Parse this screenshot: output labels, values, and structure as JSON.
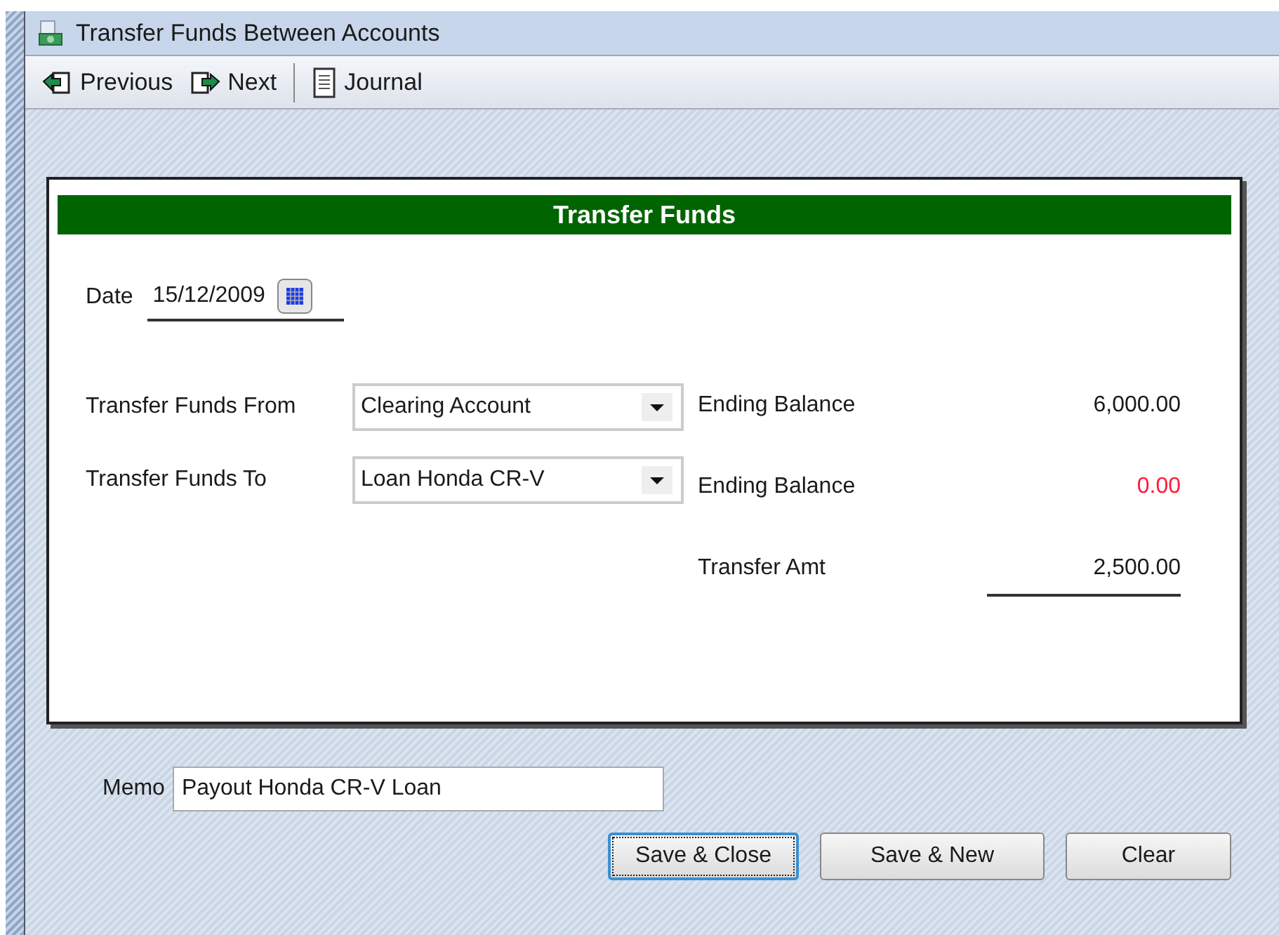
{
  "window": {
    "title": "Transfer Funds Between Accounts"
  },
  "toolbar": [
    {
      "kind": "previous",
      "label": "Previous"
    },
    {
      "kind": "next",
      "label": "Next"
    },
    {
      "kind": "journal",
      "label": "Journal"
    }
  ],
  "form": {
    "title": "Transfer Funds",
    "date": {
      "label": "Date",
      "value": "15/12/2009"
    },
    "accounts": [
      {
        "label": "Transfer Funds From",
        "value": "Clearing Account"
      },
      {
        "label": "Transfer Funds To",
        "value": "Loan Honda CR-V"
      }
    ],
    "amounts": [
      {
        "label": "Ending Balance",
        "value": "6,000.00",
        "alert": false,
        "underlined": false
      },
      {
        "label": "Ending Balance",
        "value": "0.00",
        "alert": true,
        "underlined": false
      },
      {
        "label": "Transfer Amt",
        "value": "2,500.00",
        "alert": false,
        "underlined": true
      }
    ]
  },
  "memo": {
    "label": "Memo",
    "value": "Payout Honda CR-V Loan"
  },
  "buttons": [
    {
      "label": "Save & Close",
      "focused": true
    },
    {
      "label": "Save & New",
      "focused": false
    },
    {
      "label": "Clear",
      "focused": false
    }
  ]
}
